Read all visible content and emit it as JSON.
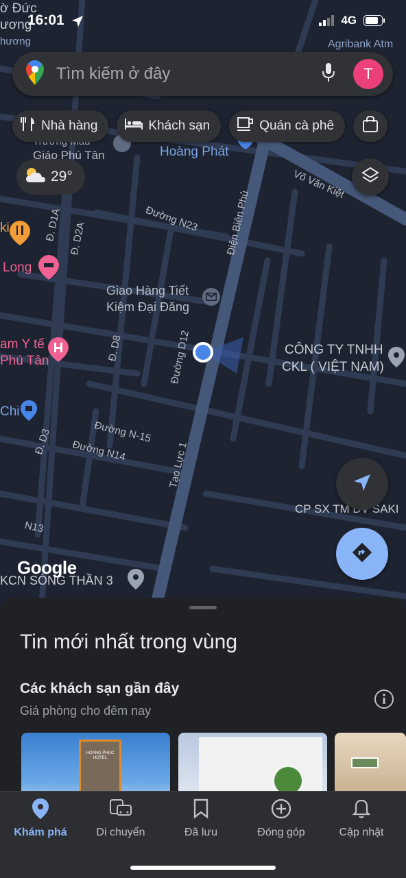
{
  "status_bar": {
    "time": "16:01",
    "network": "4G"
  },
  "search": {
    "placeholder": "Tìm kiếm ở đây",
    "avatar_letter": "T"
  },
  "chips": [
    {
      "label": "Nhà hàng",
      "icon": "fork-knife-icon"
    },
    {
      "label": "Khách sạn",
      "icon": "bed-icon"
    },
    {
      "label": "Quán cà phê",
      "icon": "coffee-cup-icon"
    },
    {
      "label": "",
      "icon": "shopping-bag-icon"
    }
  ],
  "weather": {
    "temp": "29°",
    "icon": "partly-cloudy-icon"
  },
  "map": {
    "labels": {
      "top_left_1": "ờ Đức",
      "top_left_2": "ương",
      "top_left_3": "hương",
      "agribank": "Agribank Atm",
      "truong_mau": "Trường Mầu",
      "giao_phu_tan": "Giáo Phú Tân",
      "hoang_phat": "Hoàng Phát",
      "vo_van_kiet": "Võ Văn Kiệt",
      "dien_bien_phu": "Điện Biên Phủ",
      "duong_n23": "Đường N23",
      "d_d1a": "Đ. D1A",
      "d_d2a": "Đ. D2A",
      "ki": "ki",
      "long": "Long",
      "giao_hang_1": "Giao Hàng Tiết",
      "giao_hang_2": "Kiệm Đại Đăng",
      "d_d8": "Đ. D8",
      "duong_d12": "Đường D12",
      "tam_yte": "am Y tế",
      "phu_tan": "Phú Tân",
      "cong_ty_1": "CÔNG TY TNHH",
      "cong_ty_2": "CKL ( VIỆT NAM)",
      "chi": "Chi",
      "d_d3": "Đ. D3",
      "duong_n15": "Đường N-15",
      "duong_n14": "Đường N14",
      "tao_luc_1": "Tạo Lực 1",
      "cp_sx": "CP SX TM DV SAKI",
      "n13": "N13",
      "kcn": "KCN SÓNG THẦN 3"
    },
    "attribution": "Google"
  },
  "sheet": {
    "title": "Tin mới nhất trong vùng",
    "section_title": "Các khách sạn gần đây",
    "section_subtitle": "Giá phòng cho đêm nay",
    "hotel_sign_1": "HOANG PHUC",
    "hotel_sign_2": "HOTEL"
  },
  "bottom_nav": [
    {
      "label": "Khám phá",
      "icon": "location-pin-icon",
      "active": true
    },
    {
      "label": "Di chuyển",
      "icon": "commute-icon",
      "active": false
    },
    {
      "label": "Đã lưu",
      "icon": "bookmark-icon",
      "active": false
    },
    {
      "label": "Đóng góp",
      "icon": "add-circle-icon",
      "active": false
    },
    {
      "label": "Cập nhật",
      "icon": "bell-icon",
      "active": false
    }
  ],
  "colors": {
    "accent_blue": "#8ab4f8",
    "avatar_pink": "#ec407a",
    "map_bg": "#1d2330",
    "road": "#3a4a66"
  }
}
